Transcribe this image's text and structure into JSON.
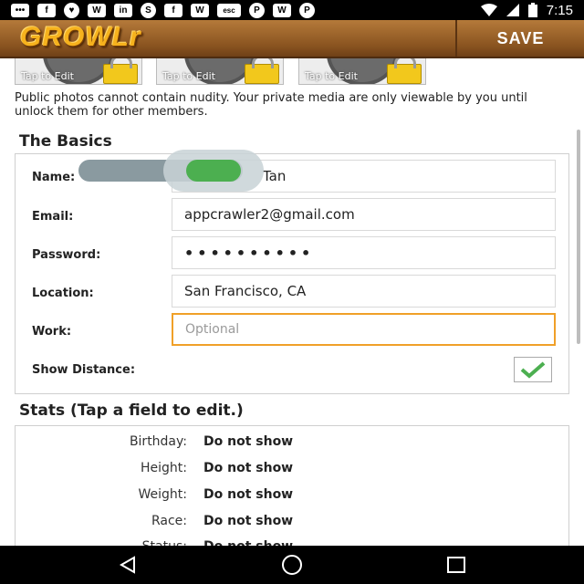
{
  "status_bar": {
    "notification_icons": [
      "talk-icon",
      "facebook-icon",
      "heart-icon",
      "wolf-icon",
      "linkedin-icon",
      "skype-icon",
      "facebook-icon",
      "wolf-icon",
      "esc-icon",
      "pinterest-icon",
      "wolf-icon",
      "pinterest-icon"
    ],
    "time": "7:15"
  },
  "app_bar": {
    "logo_text": "GROWLr",
    "save_label": "SAVE"
  },
  "photos": [
    {
      "tap_label": "Tap to Edit"
    },
    {
      "tap_label": "Tap to Edit"
    },
    {
      "tap_label": "Tap to Edit"
    }
  ],
  "notice": "Public photos cannot contain nudity.  Your private media are only viewable by you until unlock them for other members.",
  "basics": {
    "title": "The Basics",
    "name_label": "Name:",
    "name_value": "Tan",
    "email_label": "Email:",
    "email_value": "appcrawler2@gmail.com",
    "password_label": "Password:",
    "password_value": "••••••••••",
    "location_label": "Location:",
    "location_value": "San Francisco, CA",
    "work_label": "Work:",
    "work_placeholder": "Optional",
    "show_distance_label": "Show Distance:",
    "show_distance_checked": true
  },
  "stats": {
    "title": "Stats (Tap a field to edit.)",
    "rows": [
      {
        "label": "Birthday:",
        "value": "Do not show"
      },
      {
        "label": "Height:",
        "value": "Do not show"
      },
      {
        "label": "Weight:",
        "value": "Do not show"
      },
      {
        "label": "Race:",
        "value": "Do not show"
      },
      {
        "label": "Status:",
        "value": "Do not show"
      }
    ]
  },
  "colors": {
    "brand_brown": "#8a5420",
    "logo_gold": "#f6b21d",
    "focus_orange": "#f0a028",
    "check_green": "#4caf50"
  }
}
